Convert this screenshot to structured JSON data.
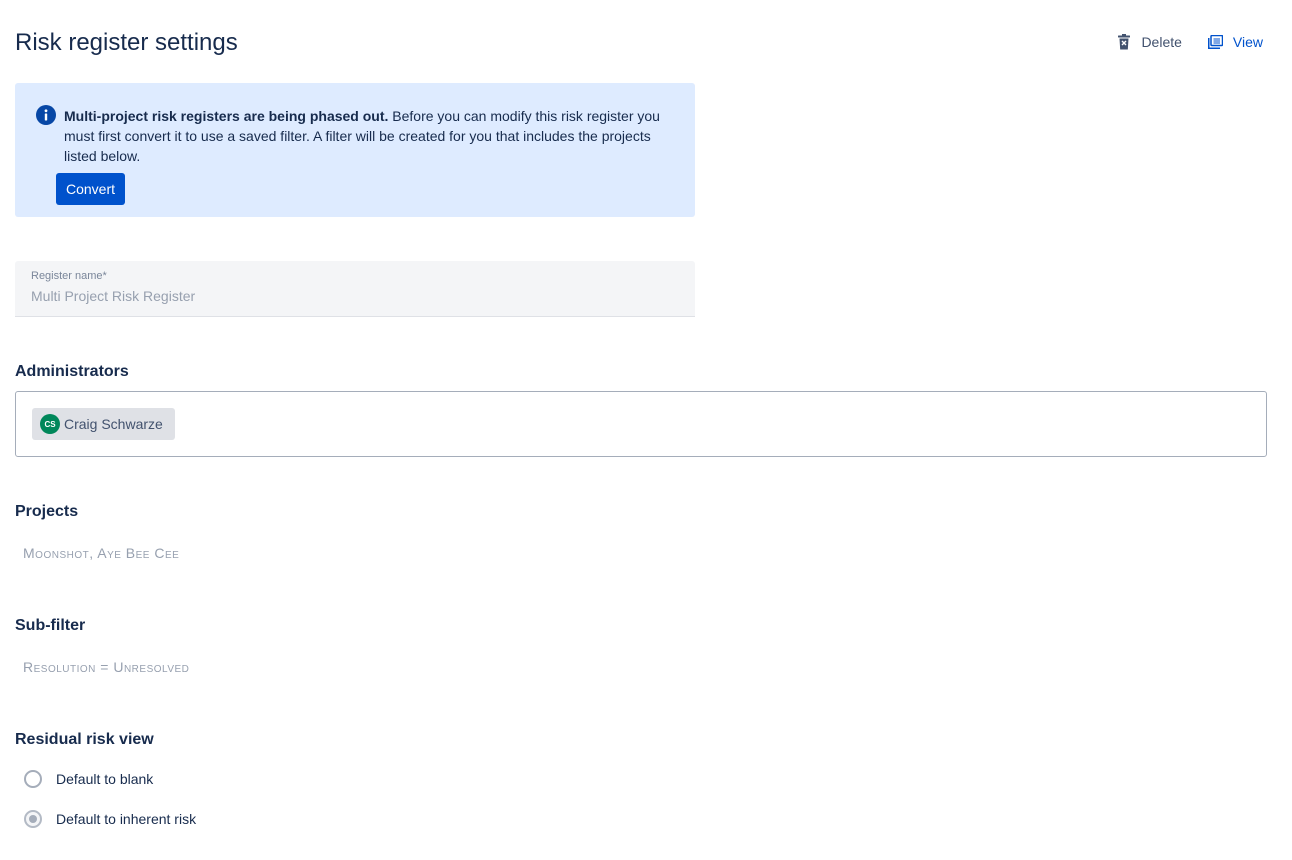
{
  "header": {
    "title": "Risk register settings",
    "actions": {
      "delete_label": "Delete",
      "view_label": "View"
    }
  },
  "banner": {
    "bold_text": "Multi-project risk registers are being phased out.",
    "body_text": " Before you can modify this risk register you must first convert it to use a saved filter. A filter will be created for you that includes the projects listed below.",
    "button_label": "Convert",
    "background_color": "#deebff",
    "icon": "info-icon"
  },
  "register_name": {
    "label": "Register name*",
    "value": "Multi Project Risk Register"
  },
  "administrators": {
    "heading": "Administrators",
    "users": [
      {
        "initials": "CS",
        "name": "Craig Schwarze",
        "avatar_color": "#00875a"
      }
    ]
  },
  "projects": {
    "heading": "Projects",
    "value": "Moonshot, Aye Bee Cee"
  },
  "sub_filter": {
    "heading": "Sub-filter",
    "value": "Resolution = Unresolved"
  },
  "residual_risk_view": {
    "heading": "Residual risk view",
    "options": [
      {
        "label": "Default to blank",
        "selected": false
      },
      {
        "label": "Default to inherent risk",
        "selected": true
      }
    ]
  },
  "colors": {
    "primary": "#0052cc",
    "text": "#172b4d",
    "muted": "#97a0af"
  }
}
